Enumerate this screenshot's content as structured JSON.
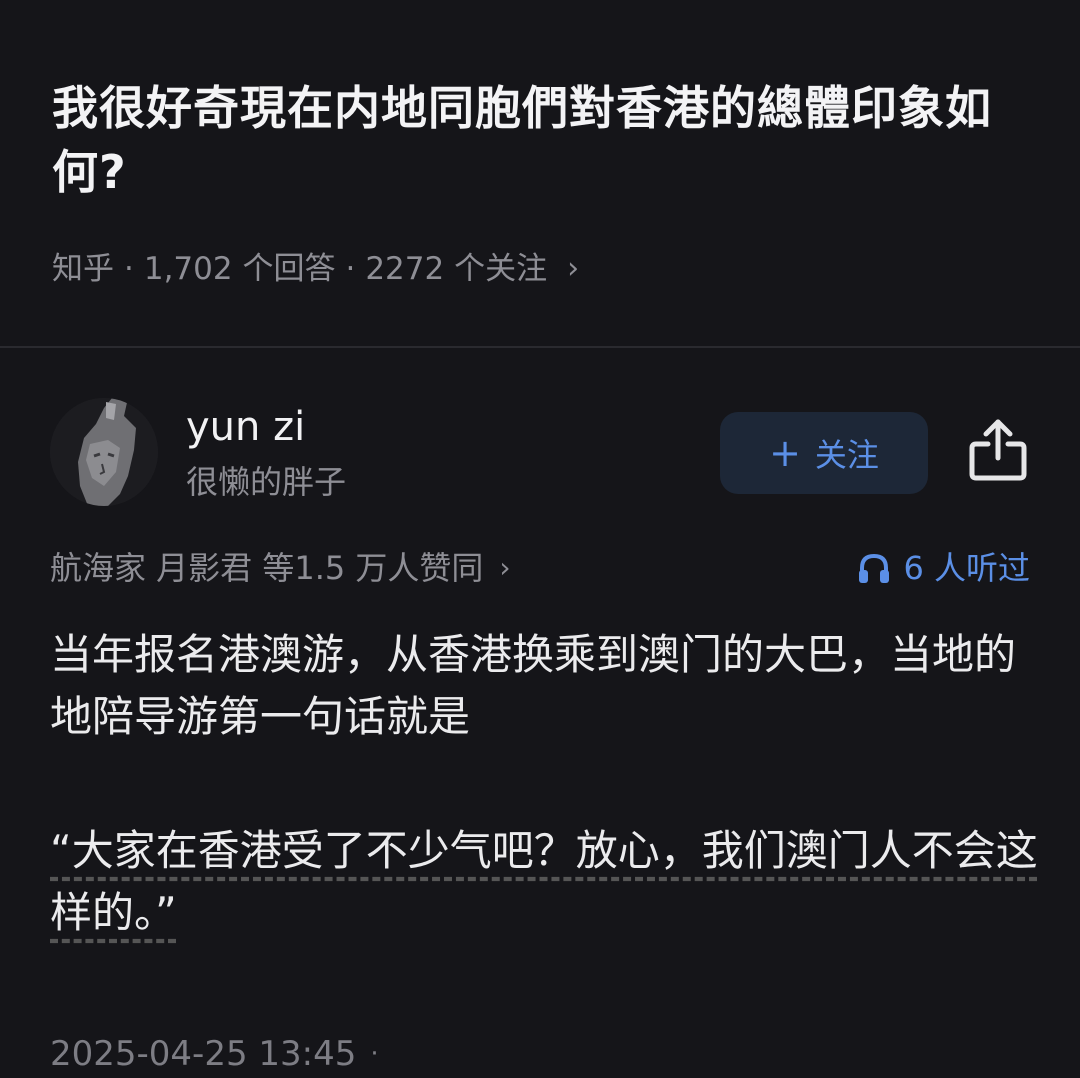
{
  "question": {
    "title": "我很好奇現在内地同胞們對香港的總體印象如何?",
    "source": "知乎",
    "answers": "1,702 个回答",
    "followers": "2272 个关注",
    "separator": "·"
  },
  "author": {
    "name": "yun zi",
    "bio": "很懒的胖子",
    "follow_label": "关注"
  },
  "approval": {
    "text": "航海家 月影君 等1.5 万人赞同",
    "listened": "6 人听过"
  },
  "answer": {
    "paragraph1": "当年报名港澳游，从香港换乘到澳门的大巴，当地的地陪导游第一句话就是",
    "paragraph2": "“大家在香港受了不少气吧？放心，我们澳门人不会这样的。”"
  },
  "footer": {
    "timestamp": "2025-04-25 13:45",
    "dot": "·"
  },
  "colors": {
    "background": "#151519",
    "accent": "#5b8fe6",
    "muted": "#8e8e95"
  }
}
